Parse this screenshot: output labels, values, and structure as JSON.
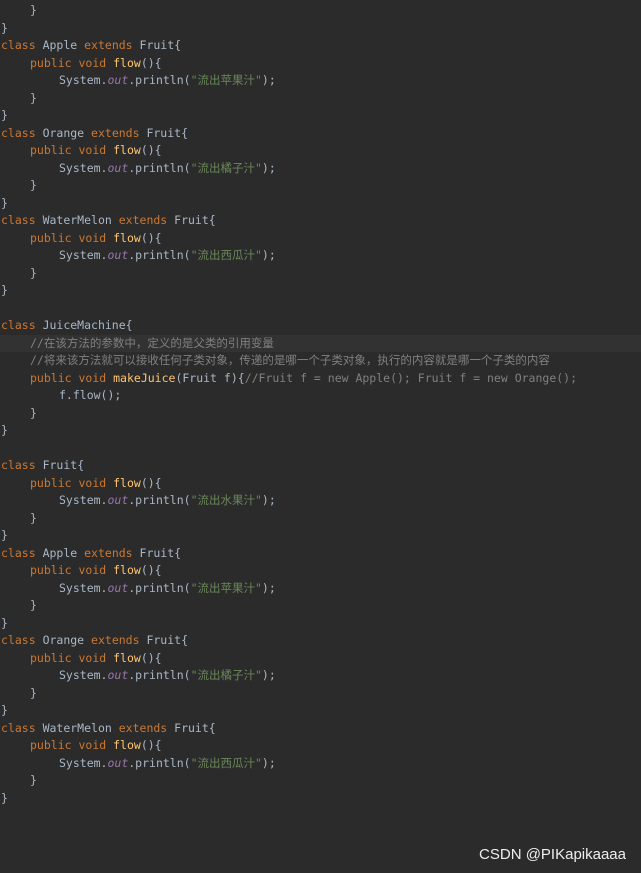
{
  "code": {
    "kw_class": "class",
    "kw_extends": "extends",
    "kw_public": "public",
    "kw_void": "void",
    "brace_close": "}",
    "brace_open": "{",
    "paren_brace": "(){",
    "fruit": "Fruit",
    "method_flow": "flow",
    "sys_out_pre": "System.",
    "sys_out_field": "out",
    "sys_out_post": ".println(",
    "close_call": ");",
    "class_apple": "Apple",
    "class_orange": "Orange",
    "class_watermelon": "WaterMelon",
    "class_juicemachine": "JuiceMachine",
    "str_apple": "\"流出苹果汁\"",
    "str_orange": "\"流出橘子汁\"",
    "str_watermelon": "\"流出西瓜汁\"",
    "str_fruit": "\"流出水果汁\"",
    "comment_1": "//在该方法的参数中，定义的是父类的引用变量",
    "comment_2": "//将来该方法就可以接收任何子类对象，传递的是哪一个子类对象，执行的内容就是哪一个子类的内容",
    "method_makejuice": "makeJuice",
    "makejuice_params": "(Fruit f){",
    "makejuice_comment": "//Fruit f = new Apple(); Fruit f = new Orange();",
    "f_flow_call": "f.flow();"
  },
  "watermark": "CSDN @PIKapikaaaa"
}
